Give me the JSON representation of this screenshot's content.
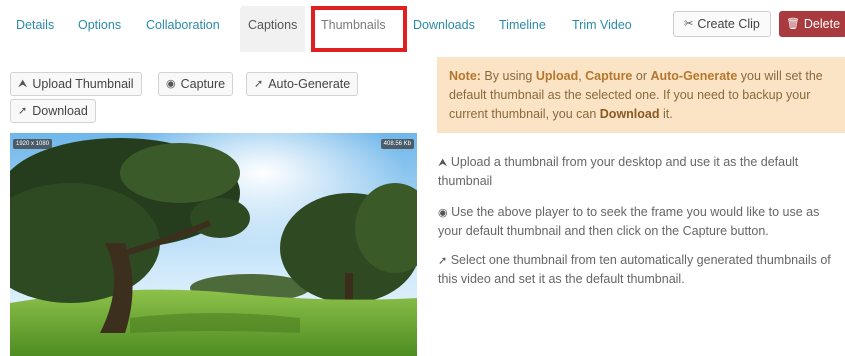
{
  "tabs": [
    {
      "label": "Details"
    },
    {
      "label": "Options"
    },
    {
      "label": "Collaboration"
    },
    {
      "label": "Captions"
    },
    {
      "label": "Thumbnails"
    },
    {
      "label": "Downloads"
    },
    {
      "label": "Timeline"
    },
    {
      "label": "Trim Video"
    }
  ],
  "actions": {
    "create_clip": "Create Clip",
    "delete": "Delete"
  },
  "toolbar": {
    "upload": "Upload Thumbnail",
    "capture": "Capture",
    "auto_generate": "Auto-Generate",
    "download": "Download"
  },
  "preview": {
    "resolution": "1920 x 1080",
    "size": "408.56 Kb"
  },
  "note": {
    "label": "Note:",
    "p1": " By using ",
    "upload": "Upload",
    "p2": ", ",
    "capture": "Capture",
    "p3": " or ",
    "auto": "Auto-Generate",
    "p4": " you will set the default thumbnail as the selected one. If you need to backup your current thumbnail, you can ",
    "download": "Download",
    "p5": " it."
  },
  "help": {
    "upload": "Upload a thumbnail from your desktop and use it as the default thumbnail",
    "capture": "Use the above player to to seek the frame you would like to use as your default thumbnail and then click on the Capture button.",
    "auto": "Select one thumbnail from ten automatically generated thumbnails of this video and set it as the default thumbnail."
  },
  "icons": {
    "upload": "upload-icon",
    "capture": "camera-icon",
    "auto": "wand-icon",
    "download": "wand-icon",
    "clip": "scissors-icon",
    "delete": "trash-icon"
  },
  "colors": {
    "tab_link": "#2b8aa8",
    "delete_bg": "#a93a3d",
    "note_bg": "#fbe3c6",
    "highlight": "#e02020"
  }
}
